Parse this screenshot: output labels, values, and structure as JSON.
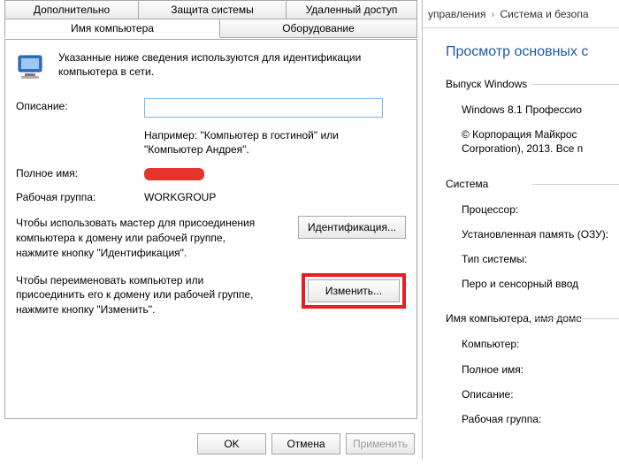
{
  "dialog": {
    "tabs_row1": [
      "Дополнительно",
      "Защита системы",
      "Удаленный доступ"
    ],
    "tabs_row2": [
      "Имя компьютера",
      "Оборудование"
    ],
    "active_tab": "Имя компьютера",
    "intro": "Указанные ниже сведения используются для идентификации компьютера в сети.",
    "description_label": "Описание:",
    "description_value": "",
    "example_hint": "Например: \"Компьютер в гостиной\" или \"Компьютер Андрея\".",
    "fullname_label": "Полное имя:",
    "workgroup_label": "Рабочая группа:",
    "workgroup_value": "WORKGROUP",
    "id_blurb": "Чтобы использовать мастер для присоединения компьютера к домену или рабочей группе, нажмите кнопку \"Идентификация\".",
    "id_button": "Идентификация...",
    "change_blurb": "Чтобы переименовать компьютер или присоединить его к домену или рабочей группе, нажмите кнопку \"Изменить\".",
    "change_button": "Изменить...",
    "ok": "OK",
    "cancel": "Отмена",
    "apply": "Применить"
  },
  "right": {
    "crumb1": "управления",
    "crumb2": "Система и безопа",
    "heading": "Просмотр основных с",
    "g1_title": "Выпуск Windows",
    "g1_p1": "Windows 8.1 Профессио",
    "g1_p2": "© Корпорация Майкрос\nCorporation), 2013. Все п",
    "g2_title": "Система",
    "g2_p1": "Процессор:",
    "g2_p2": "Установленная память\n(ОЗУ):",
    "g2_p3": "Тип системы:",
    "g2_p4": "Перо и сенсорный ввод",
    "g3_title": "Имя компьютера, имя доме",
    "g3_p1": "Компьютер:",
    "g3_p2": "Полное имя:",
    "g3_p3": "Описание:",
    "g3_p4": "Рабочая группа:"
  }
}
